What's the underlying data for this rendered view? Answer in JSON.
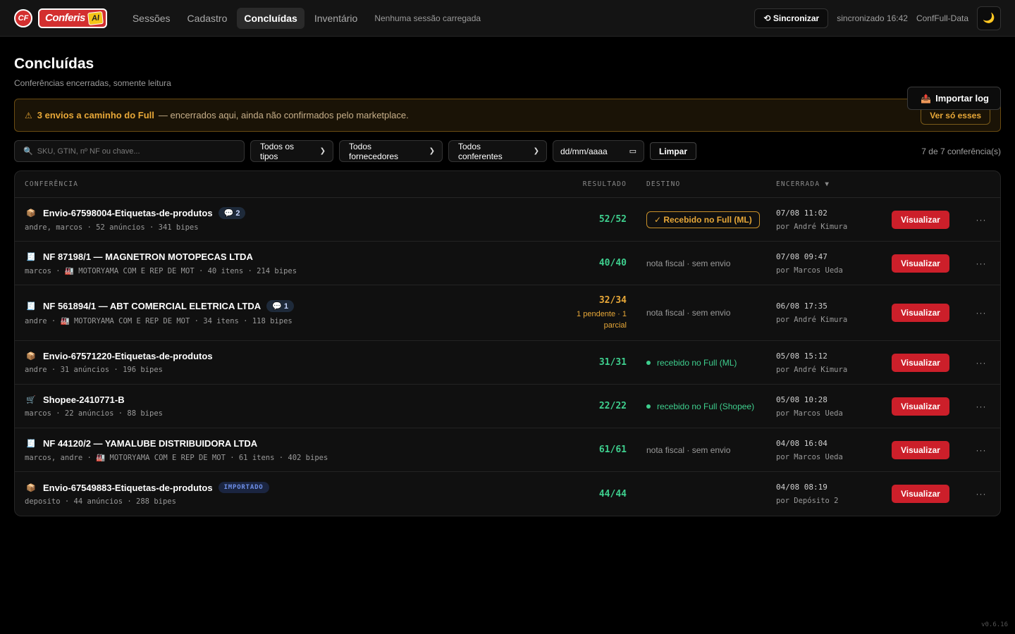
{
  "app": {
    "logo_mark": "CF",
    "logo_text": "Conferis",
    "logo_ai": "AI",
    "nav": [
      "Sessões",
      "Cadastro",
      "Concluídas",
      "Inventário"
    ],
    "active_nav": "Concluídas",
    "session_note": "Nenhuma sessão carregada",
    "sync_label": "⟲ Sincronizar",
    "sync_time": "sincronizado 16:42",
    "db_name": "ConfFull-Data",
    "theme_icon": "🌙"
  },
  "page": {
    "title": "Concluídas",
    "subtitle": "Conferências encerradas, somente leitura",
    "import_label": "Importar log",
    "import_icon": "📤"
  },
  "alert": {
    "strong": "3 envios a caminho do Full",
    "rest": "— encerrados aqui, ainda não confirmados pelo marketplace.",
    "action": "Ver só esses",
    "icon": "⚠"
  },
  "filters": {
    "search_placeholder": "SKU, GTIN, nº NF ou chave...",
    "type": "Todos os tipos",
    "supplier": "Todos fornecedores",
    "checker": "Todos conferentes",
    "date": "dd/mm/aaaa",
    "clear": "Limpar",
    "count": "7 de 7 conferência(s)"
  },
  "table": {
    "headers": {
      "conferencia": "CONFERÊNCIA",
      "resultado": "RESULTADO",
      "destino": "DESTINO",
      "encerrada": "ENCERRADA ▼"
    },
    "view_label": "Visualizar",
    "more_label": "···",
    "rows": [
      {
        "icon": "📦",
        "title": "Envio-67598004-Etiquetas-de-produtos",
        "chip": "💬 2",
        "meta": "andre, marcos · 52 anúncios · 341 bipes",
        "result": "52/52",
        "dest": "✓ Recebido no Full (ML)",
        "dest_style": "badge",
        "when": "07/08 11:02",
        "by": "por André Kimura"
      },
      {
        "icon": "🧾",
        "title": "NF 87198/1 — MAGNETRON MOTOPECAS LTDA",
        "meta": "marcos · 🏭 MOTORYAMA COM E REP DE MOT · 40 itens · 214 bipes",
        "result": "40/40",
        "dest": "nota fiscal · sem envio",
        "dest_style": "muted",
        "when": "07/08 09:47",
        "by": "por Marcos Ueda"
      },
      {
        "icon": "🧾",
        "title": "NF 561894/1 — ABT COMERCIAL ELETRICA LTDA",
        "chip": "💬 1",
        "meta": "andre · 🏭 MOTORYAMA COM E REP DE MOT · 34 itens · 118 bipes",
        "result": "32/34",
        "result_note": "1 pendente · 1 parcial",
        "dest": "nota fiscal · sem envio",
        "dest_style": "muted",
        "when": "06/08 17:35",
        "by": "por André Kimura"
      },
      {
        "icon": "📦",
        "title": "Envio-67571220-Etiquetas-de-produtos",
        "meta": "andre · 31 anúncios · 196 bipes",
        "result": "31/31",
        "dest": "recebido no Full (ML)",
        "dest_style": "ok",
        "when": "05/08 15:12",
        "by": "por André Kimura"
      },
      {
        "icon": "🛒",
        "title": "Shopee-2410771-B",
        "meta": "marcos · 22 anúncios · 88 bipes",
        "result": "22/22",
        "dest": "recebido no Full (Shopee)",
        "dest_style": "ok",
        "when": "05/08 10:28",
        "by": "por Marcos Ueda"
      },
      {
        "icon": "🧾",
        "title": "NF 44120/2 — YAMALUBE DISTRIBUIDORA LTDA",
        "meta": "marcos, andre · 🏭 MOTORYAMA COM E REP DE MOT · 61 itens · 402 bipes",
        "result": "61/61",
        "dest": "nota fiscal · sem envio",
        "dest_style": "muted",
        "when": "04/08 16:04",
        "by": "por Marcos Ueda"
      },
      {
        "icon": "📦",
        "title": "Envio-67549883-Etiquetas-de-produtos",
        "chip_imp": "IMPORTADO",
        "meta": "deposito · 44 anúncios · 288 bipes",
        "result": "44/44",
        "dest": "",
        "dest_style": "muted",
        "when": "04/08 08:19",
        "by": "por Depósito 2"
      }
    ]
  },
  "version": "v0.6.16"
}
